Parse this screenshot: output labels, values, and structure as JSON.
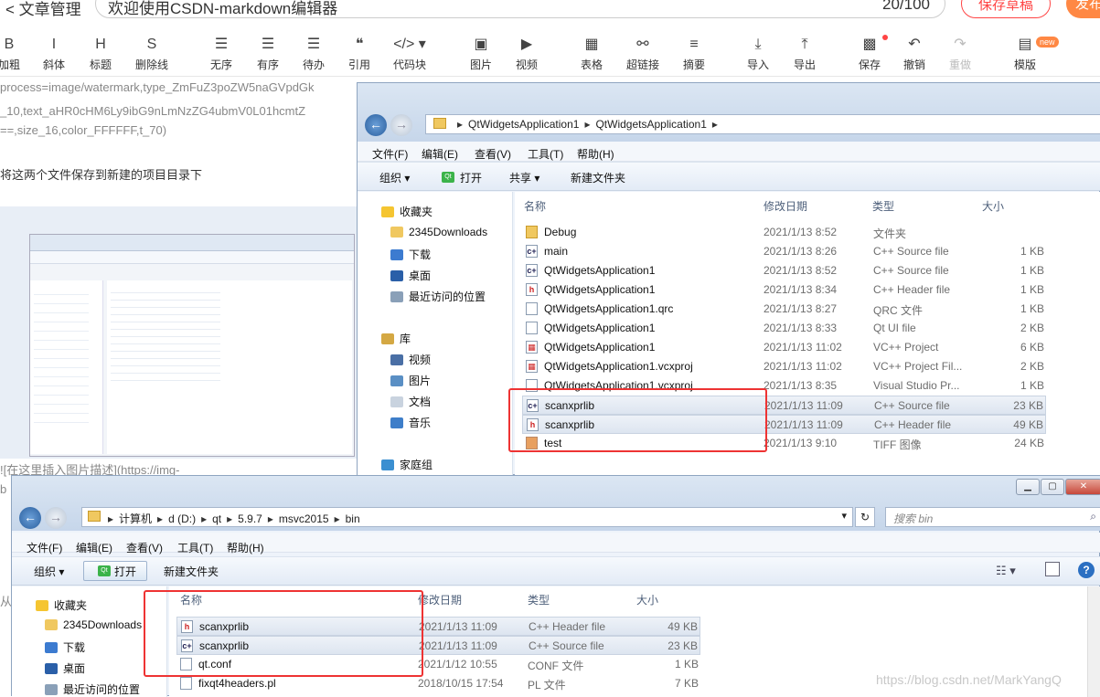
{
  "header": {
    "back_label": "< 文章管理",
    "title_value": "欢迎使用CSDN-markdown编辑器",
    "count": "20/100",
    "save_draft": "保存草稿",
    "publish": "发布"
  },
  "toolbar": {
    "items": [
      {
        "icon": "bold-icon",
        "glyph": "B",
        "label": "加粗"
      },
      {
        "icon": "italic-icon",
        "glyph": "I",
        "label": "斜体"
      },
      {
        "icon": "heading-icon",
        "glyph": "H",
        "label": "标题"
      },
      {
        "icon": "strikethrough-icon",
        "glyph": "S",
        "label": "删除线"
      },
      {
        "icon": "unordered-list-icon",
        "glyph": "☰",
        "label": "无序"
      },
      {
        "icon": "ordered-list-icon",
        "glyph": "☰",
        "label": "有序"
      },
      {
        "icon": "todo-list-icon",
        "glyph": "☰",
        "label": "待办"
      },
      {
        "icon": "quote-icon",
        "glyph": "❝",
        "label": "引用"
      },
      {
        "icon": "code-block-icon",
        "glyph": "</> ▾",
        "label": "代码块"
      },
      {
        "icon": "image-icon",
        "glyph": "▣",
        "label": "图片"
      },
      {
        "icon": "video-icon",
        "glyph": "▶",
        "label": "视频"
      },
      {
        "icon": "table-icon",
        "glyph": "▦",
        "label": "表格"
      },
      {
        "icon": "link-icon",
        "glyph": "⚯",
        "label": "超链接"
      },
      {
        "icon": "summary-icon",
        "glyph": "≡",
        "label": "摘要"
      },
      {
        "icon": "import-icon",
        "glyph": "⤓",
        "label": "导入"
      },
      {
        "icon": "export-icon",
        "glyph": "⤒",
        "label": "导出"
      },
      {
        "icon": "save-icon",
        "glyph": "▩",
        "label": "保存"
      },
      {
        "icon": "undo-icon",
        "glyph": "↶",
        "label": "撤销"
      },
      {
        "icon": "redo-icon",
        "glyph": "↷",
        "label": "重做"
      },
      {
        "icon": "template-icon",
        "glyph": "▤",
        "label": "模版"
      }
    ],
    "new_badge": "new"
  },
  "editor": {
    "line1": "process=image/watermark,type_ZmFuZ3poZW5naGVpdGk",
    "line2": "_10,text_aHR0cHM6Ly9ibG9nLmNzZG4ubmV0L01hcmtZ",
    "line3": "==,size_16,color_FFFFFF,t_70)",
    "text": "将这两个文件保存到新建的项目目录下",
    "line4": "![在这里插入图片描述](https://img-",
    "line5": "b",
    "line6": "从"
  },
  "explorer_top": {
    "breadcrumb": [
      "QtWidgetsApplication1",
      "QtWidgetsApplication1"
    ],
    "menu": [
      "文件(F)",
      "编辑(E)",
      "查看(V)",
      "工具(T)",
      "帮助(H)"
    ],
    "commands": [
      "组织 ▾",
      "打开",
      "共享 ▾",
      "新建文件夹"
    ],
    "nav": [
      "收藏夹",
      "2345Downloads",
      "下载",
      "桌面",
      "最近访问的位置",
      "库",
      "视频",
      "图片",
      "文档",
      "音乐",
      "家庭组"
    ],
    "columns": [
      "名称",
      "修改日期",
      "类型",
      "大小"
    ],
    "files": [
      {
        "name": "Debug",
        "date": "2021/1/13 8:52",
        "type": "文件夹",
        "size": "",
        "icon": "folder"
      },
      {
        "name": "main",
        "date": "2021/1/13 8:26",
        "type": "C++ Source file",
        "size": "1 KB",
        "icon": "cpp"
      },
      {
        "name": "QtWidgetsApplication1",
        "date": "2021/1/13 8:52",
        "type": "C++ Source file",
        "size": "1 KB",
        "icon": "cpp"
      },
      {
        "name": "QtWidgetsApplication1",
        "date": "2021/1/13 8:34",
        "type": "C++ Header file",
        "size": "1 KB",
        "icon": "h"
      },
      {
        "name": "QtWidgetsApplication1.qrc",
        "date": "2021/1/13 8:27",
        "type": "QRC 文件",
        "size": "1 KB",
        "icon": "doc"
      },
      {
        "name": "QtWidgetsApplication1",
        "date": "2021/1/13 8:33",
        "type": "Qt UI file",
        "size": "2 KB",
        "icon": "doc"
      },
      {
        "name": "QtWidgetsApplication1",
        "date": "2021/1/13 11:02",
        "type": "VC++ Project",
        "size": "6 KB",
        "icon": "proj"
      },
      {
        "name": "QtWidgetsApplication1.vcxproj",
        "date": "2021/1/13 11:02",
        "type": "VC++ Project Fil...",
        "size": "2 KB",
        "icon": "proj"
      },
      {
        "name": "QtWidgetsApplication1.vcxproj",
        "date": "2021/1/13 8:35",
        "type": "Visual Studio Pr...",
        "size": "1 KB",
        "icon": "doc"
      },
      {
        "name": "scanxprlib",
        "date": "2021/1/13 11:09",
        "type": "C++ Source file",
        "size": "23 KB",
        "icon": "cpp"
      },
      {
        "name": "scanxprlib",
        "date": "2021/1/13 11:09",
        "type": "C++ Header file",
        "size": "49 KB",
        "icon": "h"
      },
      {
        "name": "test",
        "date": "2021/1/13 9:10",
        "type": "TIFF 图像",
        "size": "24 KB",
        "icon": "tiff"
      }
    ]
  },
  "explorer_bottom": {
    "breadcrumb": [
      "计算机",
      "d (D:)",
      "qt",
      "5.9.7",
      "msvc2015",
      "bin"
    ],
    "search_placeholder": "搜索 bin",
    "menu": [
      "文件(F)",
      "编辑(E)",
      "查看(V)",
      "工具(T)",
      "帮助(H)"
    ],
    "commands": [
      "组织 ▾",
      "打开",
      "新建文件夹"
    ],
    "nav": [
      "收藏夹",
      "2345Downloads",
      "下载",
      "桌面",
      "最近访问的位置"
    ],
    "columns": [
      "名称",
      "修改日期",
      "类型",
      "大小"
    ],
    "files": [
      {
        "name": "scanxprlib",
        "date": "2021/1/13 11:09",
        "type": "C++ Header file",
        "size": "49 KB",
        "icon": "h"
      },
      {
        "name": "scanxprlib",
        "date": "2021/1/13 11:09",
        "type": "C++ Source file",
        "size": "23 KB",
        "icon": "cpp"
      },
      {
        "name": "qt.conf",
        "date": "2021/1/12 10:55",
        "type": "CONF 文件",
        "size": "1 KB",
        "icon": "doc"
      },
      {
        "name": "fixqt4headers.pl",
        "date": "2018/10/15 17:54",
        "type": "PL 文件",
        "size": "7 KB",
        "icon": "doc"
      }
    ]
  },
  "watermark": "https://blog.csdn.net/MarkYangQ"
}
